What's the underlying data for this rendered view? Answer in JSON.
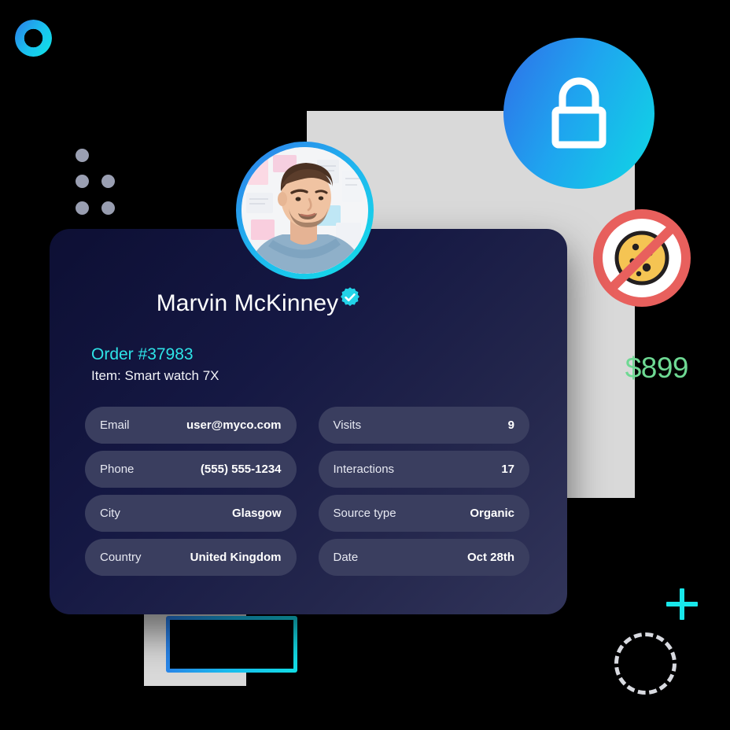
{
  "decor": {
    "logo_ring": "gradient-ring-logo",
    "dot_grid": "dot-grid-pattern",
    "plus": "plus-icon",
    "dashed_circle": "dashed-circle-outline",
    "gray_panel": "gray-background-panel",
    "outline_rect": "gradient-outline-rectangle",
    "lock_badge_icon": "lock-icon",
    "cookie_badge_icon": "no-cookies-icon"
  },
  "card": {
    "avatar_alt": "Marvin McKinney profile photo",
    "name": "Marvin McKinney",
    "verified_icon": "verified-badge-icon",
    "order_id": "Order #37983",
    "order_item": "Item: Smart watch 7X",
    "price": "$899",
    "left_rows": [
      {
        "label": "Email",
        "value": "user@myco.com"
      },
      {
        "label": "Phone",
        "value": "(555) 555-1234"
      },
      {
        "label": "City",
        "value": "Glasgow"
      },
      {
        "label": "Country",
        "value": "United Kingdom"
      }
    ],
    "right_rows": [
      {
        "label": "Visits",
        "value": "9"
      },
      {
        "label": "Interactions",
        "value": "17"
      },
      {
        "label": "Source type",
        "value": "Organic"
      },
      {
        "label": "Date",
        "value": "Oct 28th"
      }
    ]
  },
  "colors": {
    "accent_cyan": "#2ee4e8",
    "accent_blue": "#2b7de9",
    "price_green": "#6ed993",
    "card_dark": "#0d0f34",
    "card_light": "#32355a",
    "row_bg": "#3a3e5f",
    "panel_gray": "#d9d9d9",
    "dot_gray": "#9a9fb2",
    "cookie_red": "#e8605d",
    "cookie_yellow": "#f5c453"
  }
}
